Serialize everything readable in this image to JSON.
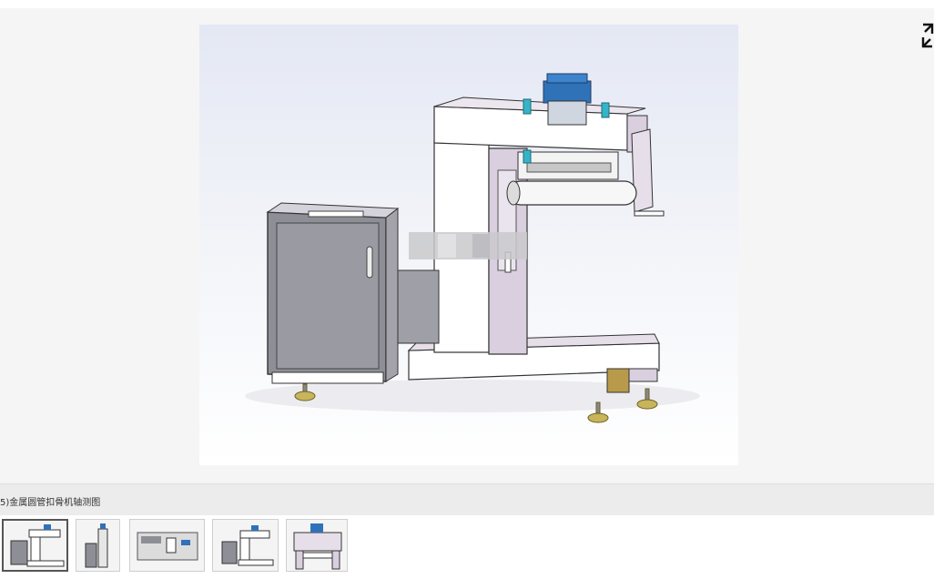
{
  "viewer": {
    "image_icon": "machine-isometric-render",
    "fullscreen_icon": "expand-icon"
  },
  "caption": {
    "text": "5)金属圆管扣骨机轴测图"
  },
  "thumbnails": [
    {
      "icon": "thumb-isometric-view",
      "active": true
    },
    {
      "icon": "thumb-side-view",
      "active": false
    },
    {
      "icon": "thumb-control-panel",
      "active": false
    },
    {
      "icon": "thumb-front-view",
      "active": false
    },
    {
      "icon": "thumb-detail-view",
      "active": false
    }
  ],
  "colors": {
    "frame": "#ffffff",
    "panel": "#d9cfdf",
    "cabinet": "#8e8f96",
    "cylinder": "#2f72b8",
    "feet": "#c8b45a"
  }
}
